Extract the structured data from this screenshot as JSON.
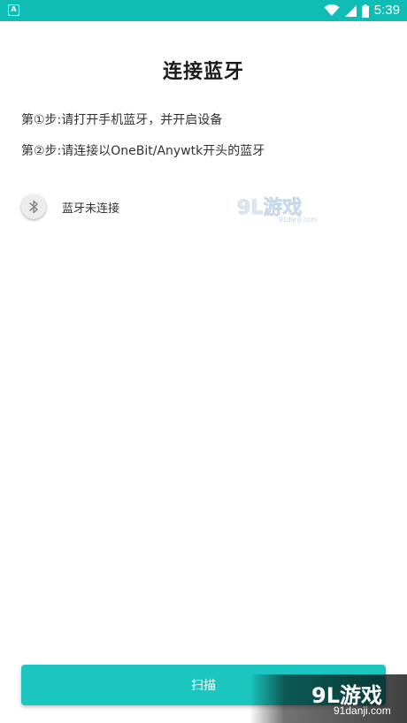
{
  "status_bar": {
    "time": "5:39",
    "left_icon": "notification-a-icon",
    "right_icons": [
      "wifi-icon",
      "cell-signal-icon",
      "battery-icon"
    ],
    "color": "#0fbdb5"
  },
  "header": {
    "title": "连接蓝牙"
  },
  "instructions": {
    "step1": "第①步:请打开手机蓝牙，并开启设备",
    "step2": "第②步:请连接以OneBit/Anywtk开头的蓝牙"
  },
  "bluetooth": {
    "icon": "bluetooth-icon",
    "status": "蓝牙未连接"
  },
  "actions": {
    "scan_label": "扫描",
    "accent_color": "#1cc6c0"
  },
  "watermark": {
    "brand": "9L游戏",
    "small_url": "91danji.com",
    "url": "91danji.com"
  }
}
